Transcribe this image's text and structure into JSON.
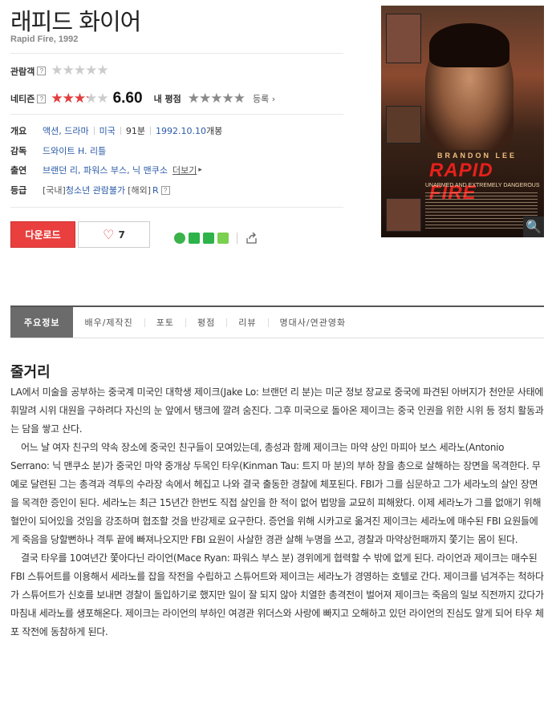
{
  "movie": {
    "title": "래피드 화이어",
    "subtitle": "Rapid Fire, 1992"
  },
  "ratings": {
    "audience_label": "관람객",
    "audience_help": "?",
    "audience_fill": 0,
    "netizen_label": "네티즌",
    "netizen_help": "?",
    "netizen_fill": 0.66,
    "netizen_score": "6.60",
    "my_label": "내 평점",
    "my_fill": 0,
    "register_link": "등록"
  },
  "info": {
    "overview_label": "개요",
    "genre": "액션, 드라마",
    "country": "미국",
    "runtime": "91분",
    "release_date": "1992.10.10",
    "release_suffix": "개봉",
    "director_label": "감독",
    "director": "드와이트 H. 리틀",
    "cast_label": "출연",
    "cast": "브랜던 리, 파워스 부스, 닉 맨쿠소",
    "more_link": "더보기",
    "grade_label": "등급",
    "grade_kr_prefix": "[국내]",
    "grade_kr": "청소년 관람불가",
    "grade_intl_prefix": "[해외]",
    "grade_intl": "R",
    "grade_help": "?"
  },
  "poster": {
    "actor_name": "BRANDON LEE",
    "title": "RAPID FIRE",
    "tagline": "UNARMED AND EXTREMELY DANGEROUS"
  },
  "actions": {
    "download_label": "다운로드",
    "like_count": "7"
  },
  "colors": {
    "accent_red": "#e9403f",
    "link_blue": "#2b5ba8",
    "tab_active": "#6b6b6b"
  },
  "tabs": [
    {
      "label": "주요정보",
      "active": true
    },
    {
      "label": "배우/제작진",
      "active": false
    },
    {
      "label": "포토",
      "active": false
    },
    {
      "label": "평점",
      "active": false
    },
    {
      "label": "리뷰",
      "active": false
    },
    {
      "label": "명대사/연관영화",
      "active": false
    }
  ],
  "synopsis": {
    "heading": "줄거리",
    "paragraphs": [
      "LA에서 미술을 공부하는 중국계 미국인 대학생 제이크(Jake Lo: 브랜던 리 분)는 미군 정보 장교로 중국에 파견된 아버지가 천안문 사태에 휘말려 시위 대원을 구하려다 자신의 눈 앞에서 탱크에 깔려 숨진다. 그후 미국으로 돌아온 제이크는 중국 인권을 위한 시위 등 정치 활동과는 담을 쌓고 산다.",
      "어느 날 여자 친구의 약속 장소에 중국인 친구들이 모여있는데, 총성과 함께 제이크는 마약 상인 마피아 보스 세라노(Antonio Serrano: 닉 맨쿠소 분)가 중국인 마약 중개상 두목인 타우(Kinman Tau: 트지 마 분)의 부하 창을 총으로 살해하는 장면을 목격한다. 무예로 달련된 그는 총격과 격투의 수라장 속에서 헤집고 나와 결국 출동한 경찰에 체포된다. FBI가 그를 심문하고 그가 세라노의 살인 장면을 목격한 증인이 된다. 세라노는 최근 15년간 한번도 직접 살인을 한 적이 없어 법망을 교묘히 피해왔다. 이제 세라노가 그를 없애기 위해 혈안이 되어있을 것임을 강조하며 협조할 것을 반강제로 요구한다. 증언을 위해 시카고로 옮겨진 제이크는 세라노에 매수된 FBI 요원들에게 죽음을 당할뻔하나 격투 끝에 빠져나오지만 FBI 요원이 사살한 경관 살해 누명을 쓰고, 경찰과 마약상헌패까지 쫓기는 몸이 된다.",
      "결국 타우를 10여년간 쫓아다닌 라이언(Mace Ryan: 파워스 부스 분) 경위에게 협력할 수 밖에 없게 된다. 라이언과 제이크는 매수된 FBI 스튜어트를 이용해서 세라노를 잡을 작전을 수립하고 스튜어트와 제이크는 세라노가 경영하는 호텔로 간다. 제이크를 넘겨주는 척하다가 스튜어트가 신호를 보내면 경찰이 돌입하기로 했지만 일이 잘 되지 않아 치열한 총격전이 벌어져 제이크는 죽음의 일보 직전까지 갔다가 마침내 세라노를 생포해온다. 제이크는 라이언의 부하인 여경관 위더스와 사랑에 빠지고 오해하고 있던 라이언의 진심도 알게 되어 타우 체포 작전에 동참하게 된다."
    ]
  }
}
